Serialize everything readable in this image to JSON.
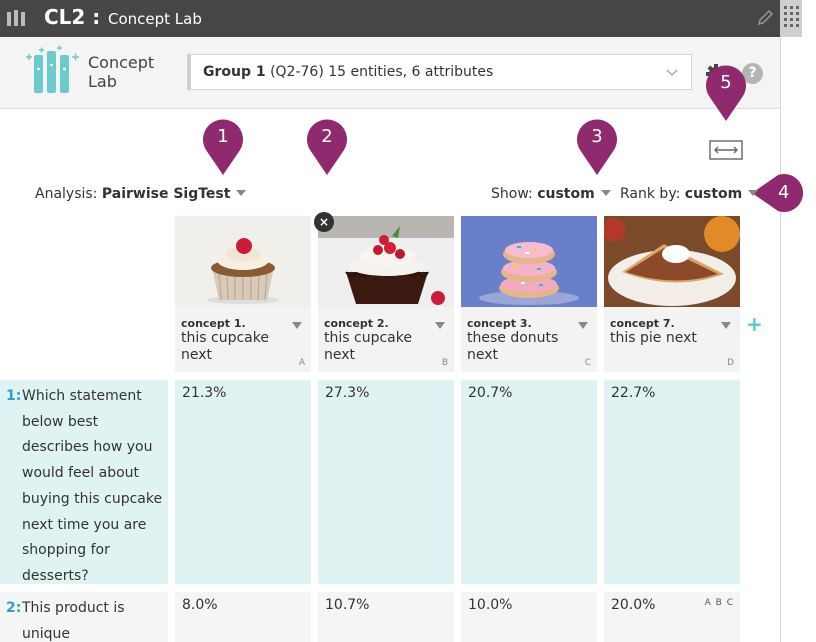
{
  "titlebar": {
    "code": "CL2 :",
    "name": "Concept Lab"
  },
  "header": {
    "logo_text_line1": "Concept",
    "logo_text_line2": "Lab",
    "group_bold": "Group 1",
    "group_rest": "(Q2-76) 15 entities, 6 attributes",
    "help_label": "?"
  },
  "callouts": [
    "1",
    "2",
    "3",
    "4",
    "5"
  ],
  "controls": {
    "analysis_label": "Analysis:",
    "analysis_value": "Pairwise SigTest",
    "show_label": "Show:",
    "show_value": "custom",
    "rank_label": "Rank by:",
    "rank_value": "custom"
  },
  "concepts": [
    {
      "name": "concept 1.",
      "text": "this cupcake next",
      "letter": "A"
    },
    {
      "name": "concept 2.",
      "text": "this cupcake next",
      "letter": "B"
    },
    {
      "name": "concept 3.",
      "text": "these donuts next",
      "letter": "C"
    },
    {
      "name": "concept 7.",
      "text": "this pie next",
      "letter": "D"
    }
  ],
  "remove_label": "×",
  "add_label": "+",
  "rows": [
    {
      "num": "1:",
      "question": "Which statement below best describes how you would feel about buying this cupcake next time you are shopping for desserts?",
      "values": [
        "21.3%",
        "27.3%",
        "20.7%",
        "22.7%"
      ],
      "sig": [
        "",
        "",
        "",
        ""
      ]
    },
    {
      "num": "2:",
      "question": "This product is unique",
      "values": [
        "8.0%",
        "10.7%",
        "10.0%",
        "20.0%"
      ],
      "sig": [
        "",
        "",
        "",
        "A B C"
      ]
    }
  ],
  "colors": {
    "accent": "#2a9fc9",
    "callout": "#8e2a6d",
    "row_highlight": "#e0f3f3",
    "titlebar": "#464646"
  }
}
